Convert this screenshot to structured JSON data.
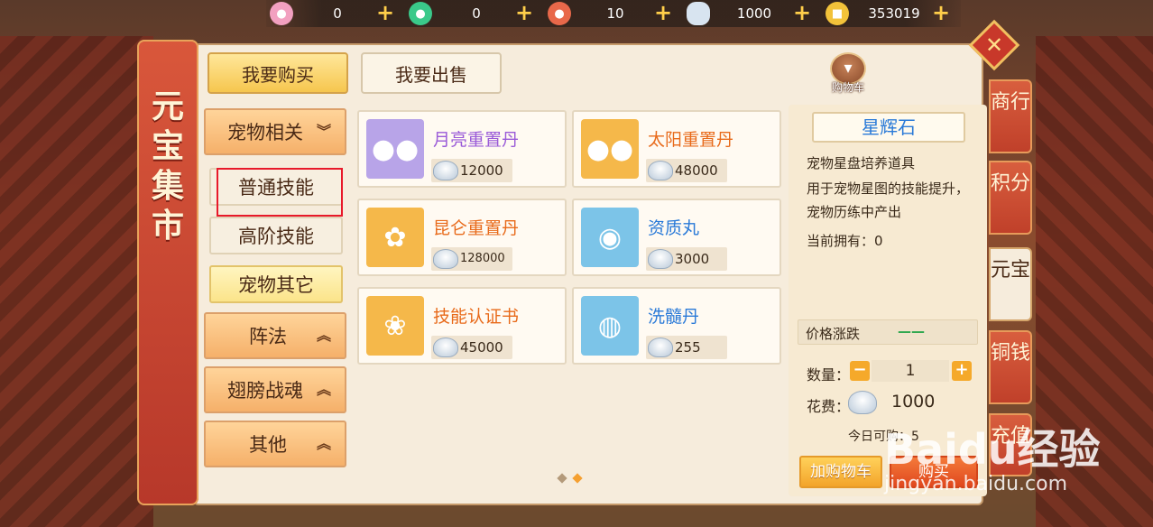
{
  "currencies": [
    {
      "icon": "pink-pet-icon",
      "color": "#f2a0c0",
      "value": "0"
    },
    {
      "icon": "green-pet-icon",
      "color": "#3ac98a",
      "value": "0"
    },
    {
      "icon": "red-pet-icon",
      "color": "#e8684a",
      "value": "10"
    },
    {
      "icon": "silver-ingot-icon",
      "color": "#d8e4f0",
      "value": "1000"
    },
    {
      "icon": "gold-coin-icon",
      "color": "#f2c23a",
      "value": "353019"
    }
  ],
  "title": "元宝集市",
  "top_buttons": {
    "buy": "我要购买",
    "sell": "我要出售"
  },
  "cart_label": "购物车",
  "categories": {
    "pet_related": "宠物相关",
    "normal_skill": "普通技能",
    "advanced_skill": "高阶技能",
    "pet_other": "宠物其它",
    "formation": "阵法",
    "wings": "翅膀战魂",
    "other": "其他"
  },
  "items": [
    {
      "name": "月亮重置丹",
      "price": "12000",
      "name_color": "#9a5ad8",
      "img_bg": "#b8a4e8",
      "icon": "purple-pills-icon"
    },
    {
      "name": "太阳重置丹",
      "price": "48000",
      "name_color": "#e86a1a",
      "img_bg": "#f5b84a",
      "icon": "golden-pills-icon"
    },
    {
      "name": "昆仑重置丹",
      "price": "128000",
      "name_color": "#e86a1a",
      "img_bg": "#f5b84a",
      "icon": "red-pills-icon"
    },
    {
      "name": "资质丸",
      "price": "3000",
      "name_color": "#2a7ad8",
      "img_bg": "#7cc4e8",
      "icon": "green-orb-icon"
    },
    {
      "name": "技能认证书",
      "price": "45000",
      "name_color": "#e86a1a",
      "img_bg": "#f5b84a",
      "icon": "scroll-icon"
    },
    {
      "name": "洗髓丹",
      "price": "255",
      "name_color": "#2a7ad8",
      "img_bg": "#7cc4e8",
      "icon": "purple-pot-icon"
    }
  ],
  "detail": {
    "name": "星辉石",
    "line1": "宠物星盘培养道具",
    "line2": "用于宠物星图的技能提升，",
    "line3": "宠物历练中产出",
    "owned": "当前拥有：0",
    "price_trend_label": "价格涨跌",
    "price_trend_value": "——",
    "qty_label": "数量：",
    "qty_value": "1",
    "cost_label": "花费：",
    "cost_value": "1000",
    "today_label": "今日可购：5",
    "add_cart": "加购物车",
    "buy": "购买"
  },
  "side_tabs": [
    "商行",
    "积分",
    "元宝",
    "铜钱",
    "充值"
  ],
  "watermark": {
    "logo": "Baidu经验",
    "url": "jingyan.baidu.com"
  }
}
